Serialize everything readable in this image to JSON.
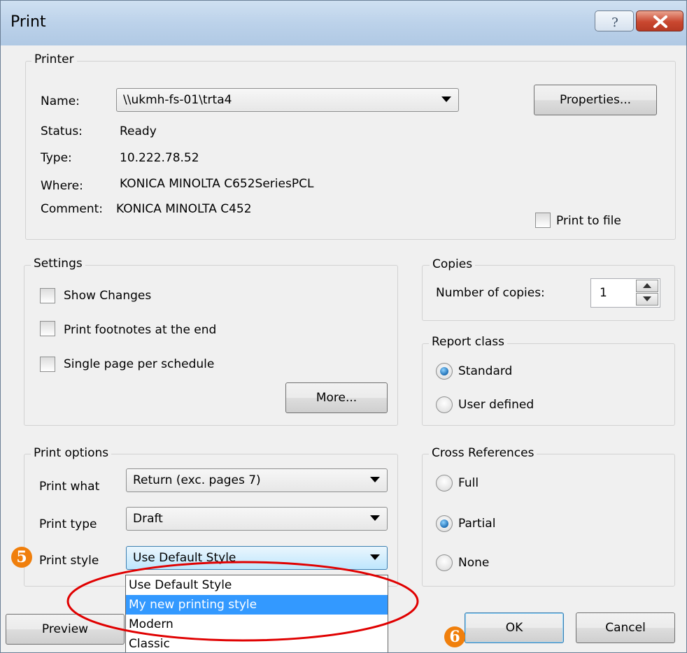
{
  "window": {
    "title": "Print"
  },
  "printer": {
    "legend": "Printer",
    "name_label": "Name:",
    "name_value": "\\\\ukmh-fs-01\\trta4",
    "status_label": "Status:",
    "status_value": "Ready",
    "type_label": "Type:",
    "type_value": "10.222.78.52",
    "where_label": "Where:",
    "where_value": "KONICA MINOLTA C652SeriesPCL",
    "comment_label": "Comment:",
    "comment_value": "KONICA MINOLTA C452",
    "properties_button": "Properties...",
    "print_to_file": "Print to file"
  },
  "settings": {
    "legend": "Settings",
    "show_changes": "Show Changes",
    "print_footnotes": "Print footnotes at the end",
    "single_page": "Single page per schedule",
    "more_button": "More..."
  },
  "copies": {
    "legend": "Copies",
    "label": "Number of copies:",
    "value": "1"
  },
  "report_class": {
    "legend": "Report class",
    "standard": "Standard",
    "user_defined": "User defined"
  },
  "print_options": {
    "legend": "Print options",
    "print_what_label": "Print what",
    "print_what_value": "Return (exc. pages 7)",
    "print_type_label": "Print type",
    "print_type_value": "Draft",
    "print_style_label": "Print style",
    "print_style_value": "Use Default Style",
    "style_options": [
      "Use Default Style",
      "My new printing style",
      "Modern",
      "Classic"
    ]
  },
  "cross_references": {
    "legend": "Cross References",
    "full": "Full",
    "partial": "Partial",
    "none": "None"
  },
  "buttons": {
    "preview": "Preview",
    "ok": "OK",
    "cancel": "Cancel"
  },
  "annotations": {
    "step5": "5",
    "step6": "6",
    "highlight_color": "#e00000",
    "step_color": "#f07f0c"
  }
}
